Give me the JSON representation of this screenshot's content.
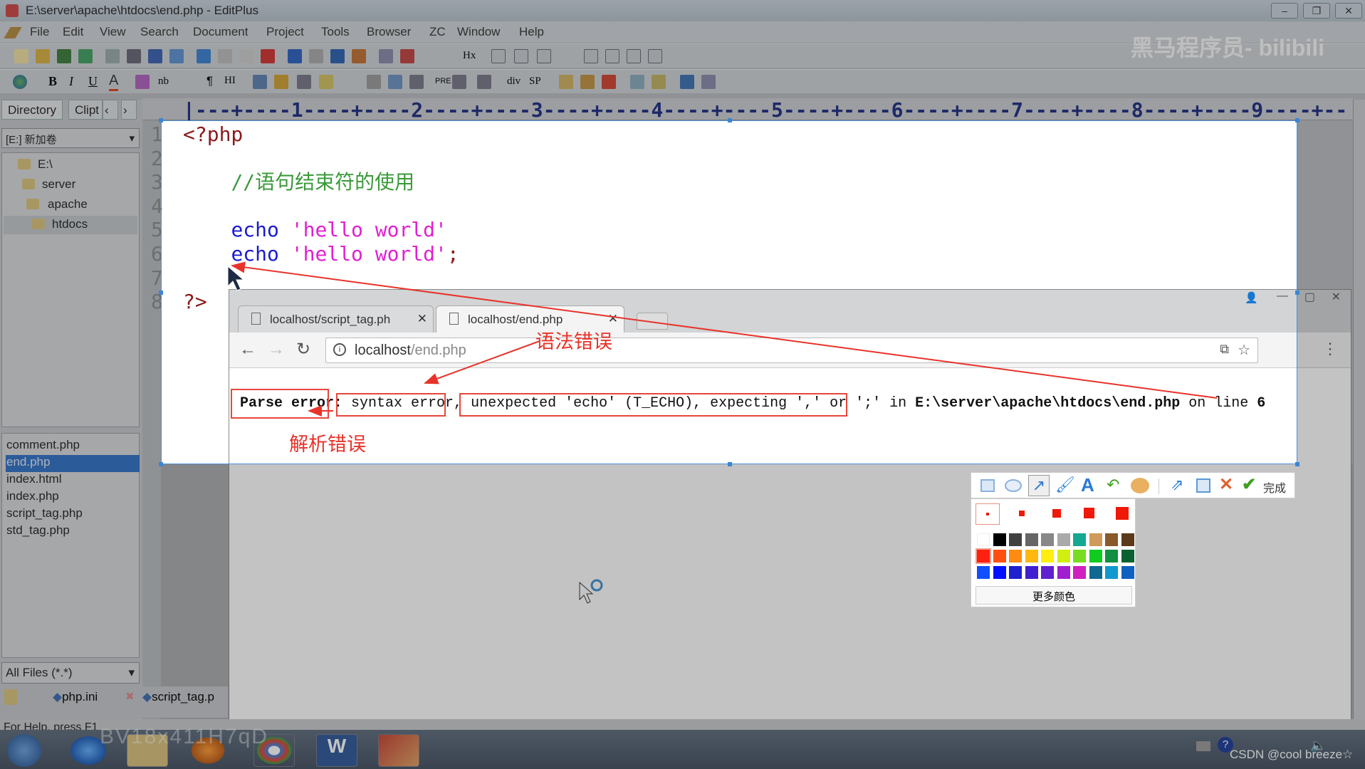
{
  "window": {
    "title": "E:\\server\\apache\\htdocs\\end.php - EditPlus",
    "minimize": "–",
    "restore": "❐",
    "close": "✕"
  },
  "menu": [
    "File",
    "Edit",
    "View",
    "Search",
    "Document",
    "Project",
    "Tools",
    "Browser",
    "ZC",
    "Window",
    "Help"
  ],
  "toolbar2_labels": {
    "bold": "B",
    "italic": "I",
    "underline": "U",
    "font_color": "A",
    "nb": "nb",
    "para": "¶",
    "hi": "HI",
    "pre": "PRE",
    "div": "div",
    "sp": "SP",
    "hx": "Hx"
  },
  "left_panel": {
    "tabs": [
      "Directory",
      "Clipt"
    ],
    "drive": "[E:] 新加卷",
    "tree": [
      "E:\\",
      "server",
      "apache",
      "htdocs"
    ],
    "files": [
      "comment.php",
      "end.php",
      "index.html",
      "index.php",
      "script_tag.php",
      "std_tag.php"
    ],
    "selected_file": "end.php",
    "filter": "All Files (*.*)"
  },
  "doc_tabs": [
    "php.ini",
    "script_tag.p"
  ],
  "ruler": "|---+----1----+----2----+----3----+----4----+----5----+----6----+----7----+----8----+----9----+--",
  "code": {
    "line_numbers": [
      "1",
      "2",
      "3",
      "4",
      "5",
      "6",
      "7",
      "8"
    ],
    "l1": "<?php",
    "l3": "//语句结束符的使用",
    "echo": "echo",
    "str": "'hello world'",
    "semi": ";",
    "l8": "?>"
  },
  "browser": {
    "tabs": [
      "localhost/script_tag.ph",
      "localhost/end.php"
    ],
    "url_host": "localhost",
    "url_path": "/end.php",
    "error": {
      "p1": "Parse error",
      "p2": ": syntax error, unexpected 'echo' (T_ECHO), expecting ',' or ';' in ",
      "path": "E:\\server\\apache\\htdocs\\end.php",
      "p3": " on line ",
      "line": "6"
    }
  },
  "annotations": {
    "syntax": "语法错误",
    "parse": "解析错误",
    "color": "#e8332a"
  },
  "snip_toolbar": {
    "done": "完成",
    "more_colors": "更多颜色",
    "colors": [
      "#ffffff",
      "#000000",
      "#404040",
      "#666666",
      "#888888",
      "#aaaaaa",
      "#16a890",
      "#d09a5a",
      "#8a5a2a",
      "#5a3a1a",
      "#ff2010",
      "#ff5010",
      "#ff8c10",
      "#ffb810",
      "#ffee10",
      "#d0ee10",
      "#78dd20",
      "#10cc20",
      "#109040",
      "#0a6030",
      "#1050ff",
      "#0010ff",
      "#2020d0",
      "#4020d0",
      "#6020d0",
      "#a020d0",
      "#d020c0",
      "#106890",
      "#1098d0",
      "#1060c0"
    ]
  },
  "status": "For Help, press F1",
  "watermarks": {
    "brand": "黑马程序员- bilibili",
    "bv": "BV18x411H7qD",
    "csdn": "CSDN @cool breeze☆"
  }
}
